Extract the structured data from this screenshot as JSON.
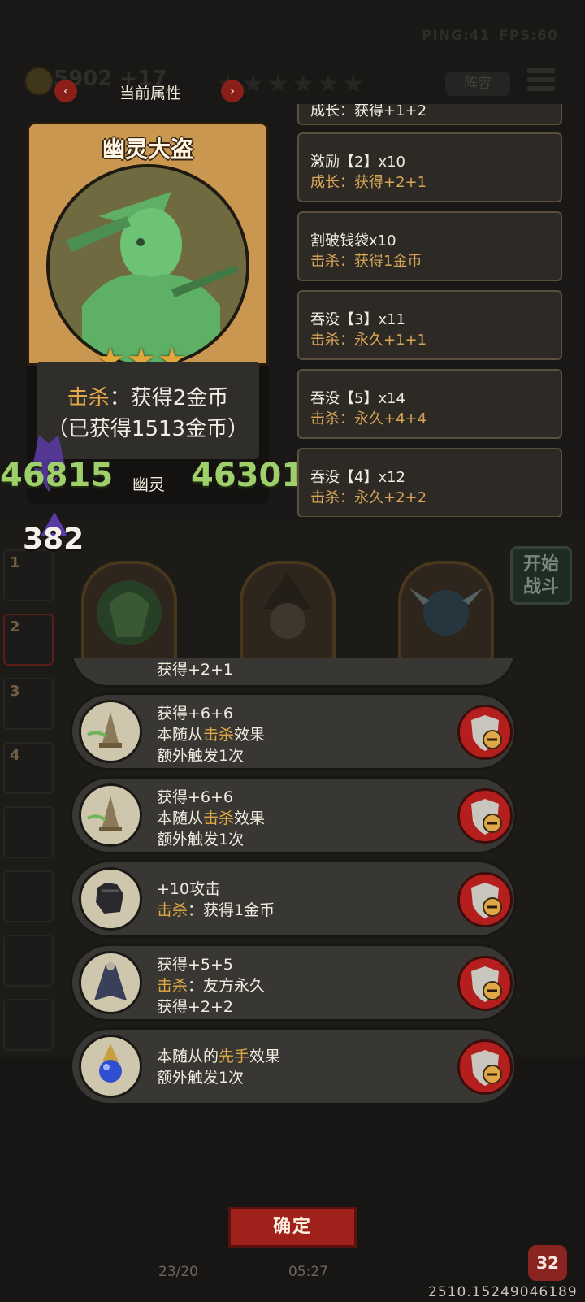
{
  "hud": {
    "ping": "PING:41",
    "fps": "FPS:60",
    "gold": "5902 +17",
    "lineup_label": "阵容",
    "top_stars": "★★★★★★"
  },
  "attributes_panel": {
    "title": "当前属性",
    "prev_glyph": "‹",
    "next_glyph": "›",
    "items": [
      {
        "line1": "成长：获得+1+2",
        "line2": ""
      },
      {
        "line1": "激励【2】x10",
        "line2": "成长：获得+2+1"
      },
      {
        "line1": "割破钱袋x10",
        "line2": "击杀：获得1金币"
      },
      {
        "line1": "吞没【3】x11",
        "line2": "击杀：永久+1+1"
      },
      {
        "line1": "吞没【5】x14",
        "line2": "击杀：永久+4+4"
      },
      {
        "line1": "吞没【4】x12",
        "line2": "击杀：永久+2+2"
      }
    ]
  },
  "hero": {
    "name": "幽灵大盗",
    "stars": "★★★",
    "effect_keyword": "击杀",
    "effect_rest": "：获得2金币",
    "obtained": "（已获得1513金币）",
    "type": "幽灵",
    "attack": "46815",
    "health": "46301"
  },
  "damage_number": "382",
  "side_slots": [
    "1",
    "2",
    "3",
    "4"
  ],
  "start_battle": "开始战斗",
  "equipment": [
    {
      "icon": "bell-icon",
      "lines": [
        [
          "获得+6+6"
        ],
        [
          "本随从",
          "击杀",
          "效果"
        ],
        [
          "额外触发1次"
        ]
      ]
    },
    {
      "icon": "bell-icon",
      "lines": [
        [
          "获得+6+6"
        ],
        [
          "本随从",
          "击杀",
          "效果"
        ],
        [
          "额外触发1次"
        ]
      ]
    },
    {
      "icon": "glove-icon",
      "lines": [
        [
          "+10攻击"
        ],
        [
          "",
          "击杀",
          "：获得1金币"
        ]
      ]
    },
    {
      "icon": "cloak-icon",
      "lines": [
        [
          "获得+5+5"
        ],
        [
          "",
          "击杀",
          "：友方永久"
        ],
        [
          "获得+2+2"
        ]
      ]
    },
    {
      "icon": "orb-icon",
      "lines": [
        [
          "本随从的",
          "先手",
          "效果"
        ],
        [
          "额外触发1次"
        ]
      ]
    }
  ],
  "confirm_label": "确定",
  "deck_count": "23/20",
  "timer": "05:27",
  "hp": "32",
  "version": "2510.15249046189",
  "colors": {
    "keyword": "#e2a846",
    "number_green": "#9fcf6b",
    "button_red": "#a0201c"
  }
}
